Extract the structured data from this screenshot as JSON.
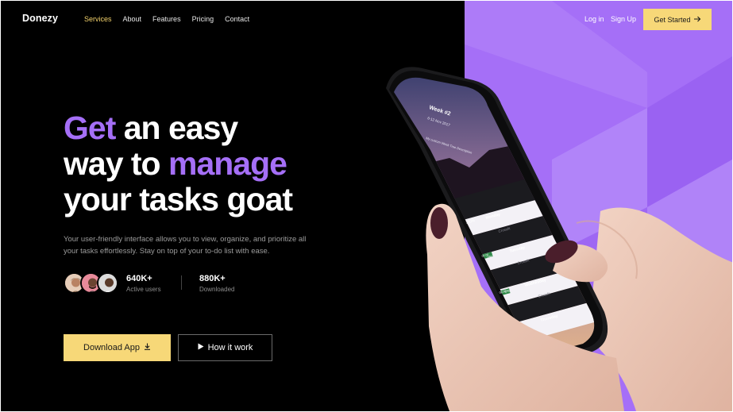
{
  "brand": {
    "logo": "Donezy"
  },
  "nav": {
    "items": [
      {
        "label": "Services",
        "active": true
      },
      {
        "label": "About",
        "active": false
      },
      {
        "label": "Features",
        "active": false
      },
      {
        "label": "Pricing",
        "active": false
      },
      {
        "label": "Contact",
        "active": false
      }
    ],
    "login": "Log in",
    "signup": "Sign Up",
    "cta": "Get Started",
    "cta_icon": "arrow-right-icon"
  },
  "hero": {
    "headline": {
      "line1_accent": "Get",
      "line1_rest": " an easy",
      "line2_start": "way to ",
      "line2_accent": "manage",
      "line3": "your tasks goat"
    },
    "subtext": "Your user-friendly interface allows you to view, organize, and prioritize all your tasks effortlessly. Stay on top of your to-do list with ease.",
    "stats": [
      {
        "value": "640K+",
        "label": "Active users"
      },
      {
        "value": "880K+",
        "label": "Downloaded"
      }
    ],
    "download_label": "Download App",
    "download_icon": "download-icon",
    "how_label": "How it work",
    "how_icon": "play-icon"
  },
  "phone": {
    "week_title": "Week #2",
    "week_dates": "6-12 Nov 2017",
    "placeholder": "My custom Week Tree Description",
    "rows": [
      {
        "percent": "100%",
        "day": "Monday",
        "task": "Crossfit"
      },
      {
        "percent": "0%",
        "day": "Tuesday",
        "task": "Crossfit",
        "time": "07:00"
      },
      {
        "percent": "0%",
        "day": "Wednesday",
        "task": "Crossfit",
        "time": "08:00"
      },
      {
        "percent": "0%",
        "day": "Thursday"
      }
    ]
  },
  "colors": {
    "accent_purple": "#a56ff7",
    "accent_yellow": "#f7d878",
    "background": "#000000"
  }
}
